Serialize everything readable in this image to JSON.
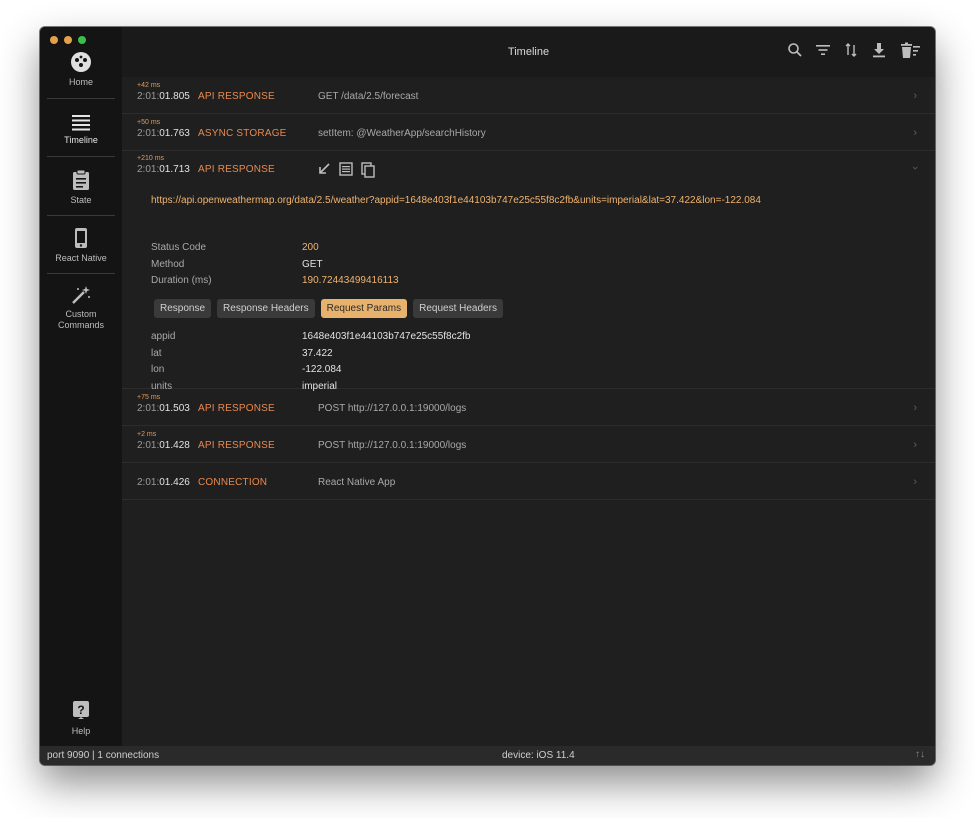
{
  "window": {
    "traffic_colors": [
      "#e5a14a",
      "#e5a14a",
      "#3bbf48"
    ]
  },
  "sidebar": {
    "items": [
      {
        "label": "Home",
        "icon": "home-logo-icon"
      },
      {
        "label": "Timeline",
        "icon": "timeline-lines-icon"
      },
      {
        "label": "State",
        "icon": "clipboard-icon"
      },
      {
        "label": "React Native",
        "icon": "phone-icon"
      },
      {
        "label": "Custom\nCommands",
        "icon": "magic-wand-icon"
      },
      {
        "label": "Help",
        "icon": "help-icon"
      }
    ],
    "active": "Timeline"
  },
  "header": {
    "title": "Timeline",
    "icons": [
      "search-icon",
      "filter-icon",
      "sort-icon",
      "download-icon",
      "trash-icon"
    ]
  },
  "timeline": {
    "rows": [
      {
        "delta": "+42 ms",
        "time_prefix": "2:01:",
        "time_main": "01.805",
        "type": "API RESPONSE",
        "desc": "GET /data/2.5/forecast"
      },
      {
        "delta": "+50 ms",
        "time_prefix": "2:01:",
        "time_main": "01.763",
        "type": "ASYNC STORAGE",
        "desc": "setItem: @WeatherApp/searchHistory"
      },
      {
        "delta": "+210 ms",
        "time_prefix": "2:01:",
        "time_main": "01.713",
        "type": "API RESPONSE",
        "desc": ""
      },
      {
        "delta": "+75 ms",
        "time_prefix": "2:01:",
        "time_main": "01.503",
        "type": "API RESPONSE",
        "desc": "POST http://127.0.0.1:19000/logs"
      },
      {
        "delta": "+2 ms",
        "time_prefix": "2:01:",
        "time_main": "01.428",
        "type": "API RESPONSE",
        "desc": "POST http://127.0.0.1:19000/logs"
      },
      {
        "delta": "",
        "time_prefix": "2:01:",
        "time_main": "01.426",
        "type": "CONNECTION",
        "desc": "React Native App"
      }
    ],
    "expanded": {
      "url": "https://api.openweathermap.org/data/2.5/weather?appid=1648e403f1e44103b747e25c55f8c2fb&units=imperial&lat=37.422&lon=-122.084",
      "status_label": "Status Code",
      "status_value": "200",
      "method_label": "Method",
      "method_value": "GET",
      "duration_label": "Duration (ms)",
      "duration_value": "190.72443499416113",
      "tabs": [
        "Response",
        "Response Headers",
        "Request Params",
        "Request Headers"
      ],
      "active_tab": "Request Params",
      "params": [
        {
          "key": "appid",
          "value": "1648e403f1e44103b747e25c55f8c2fb"
        },
        {
          "key": "lat",
          "value": "37.422"
        },
        {
          "key": "lon",
          "value": "-122.084"
        },
        {
          "key": "units",
          "value": "imperial"
        }
      ]
    }
  },
  "statusbar": {
    "left": "port 9090 | 1 connections",
    "center": "device: iOS 11.4",
    "right": "↑↓"
  },
  "colors": {
    "accent": "#e8894f",
    "url": "#f1b36f",
    "active_tab": "#e7b36c"
  }
}
